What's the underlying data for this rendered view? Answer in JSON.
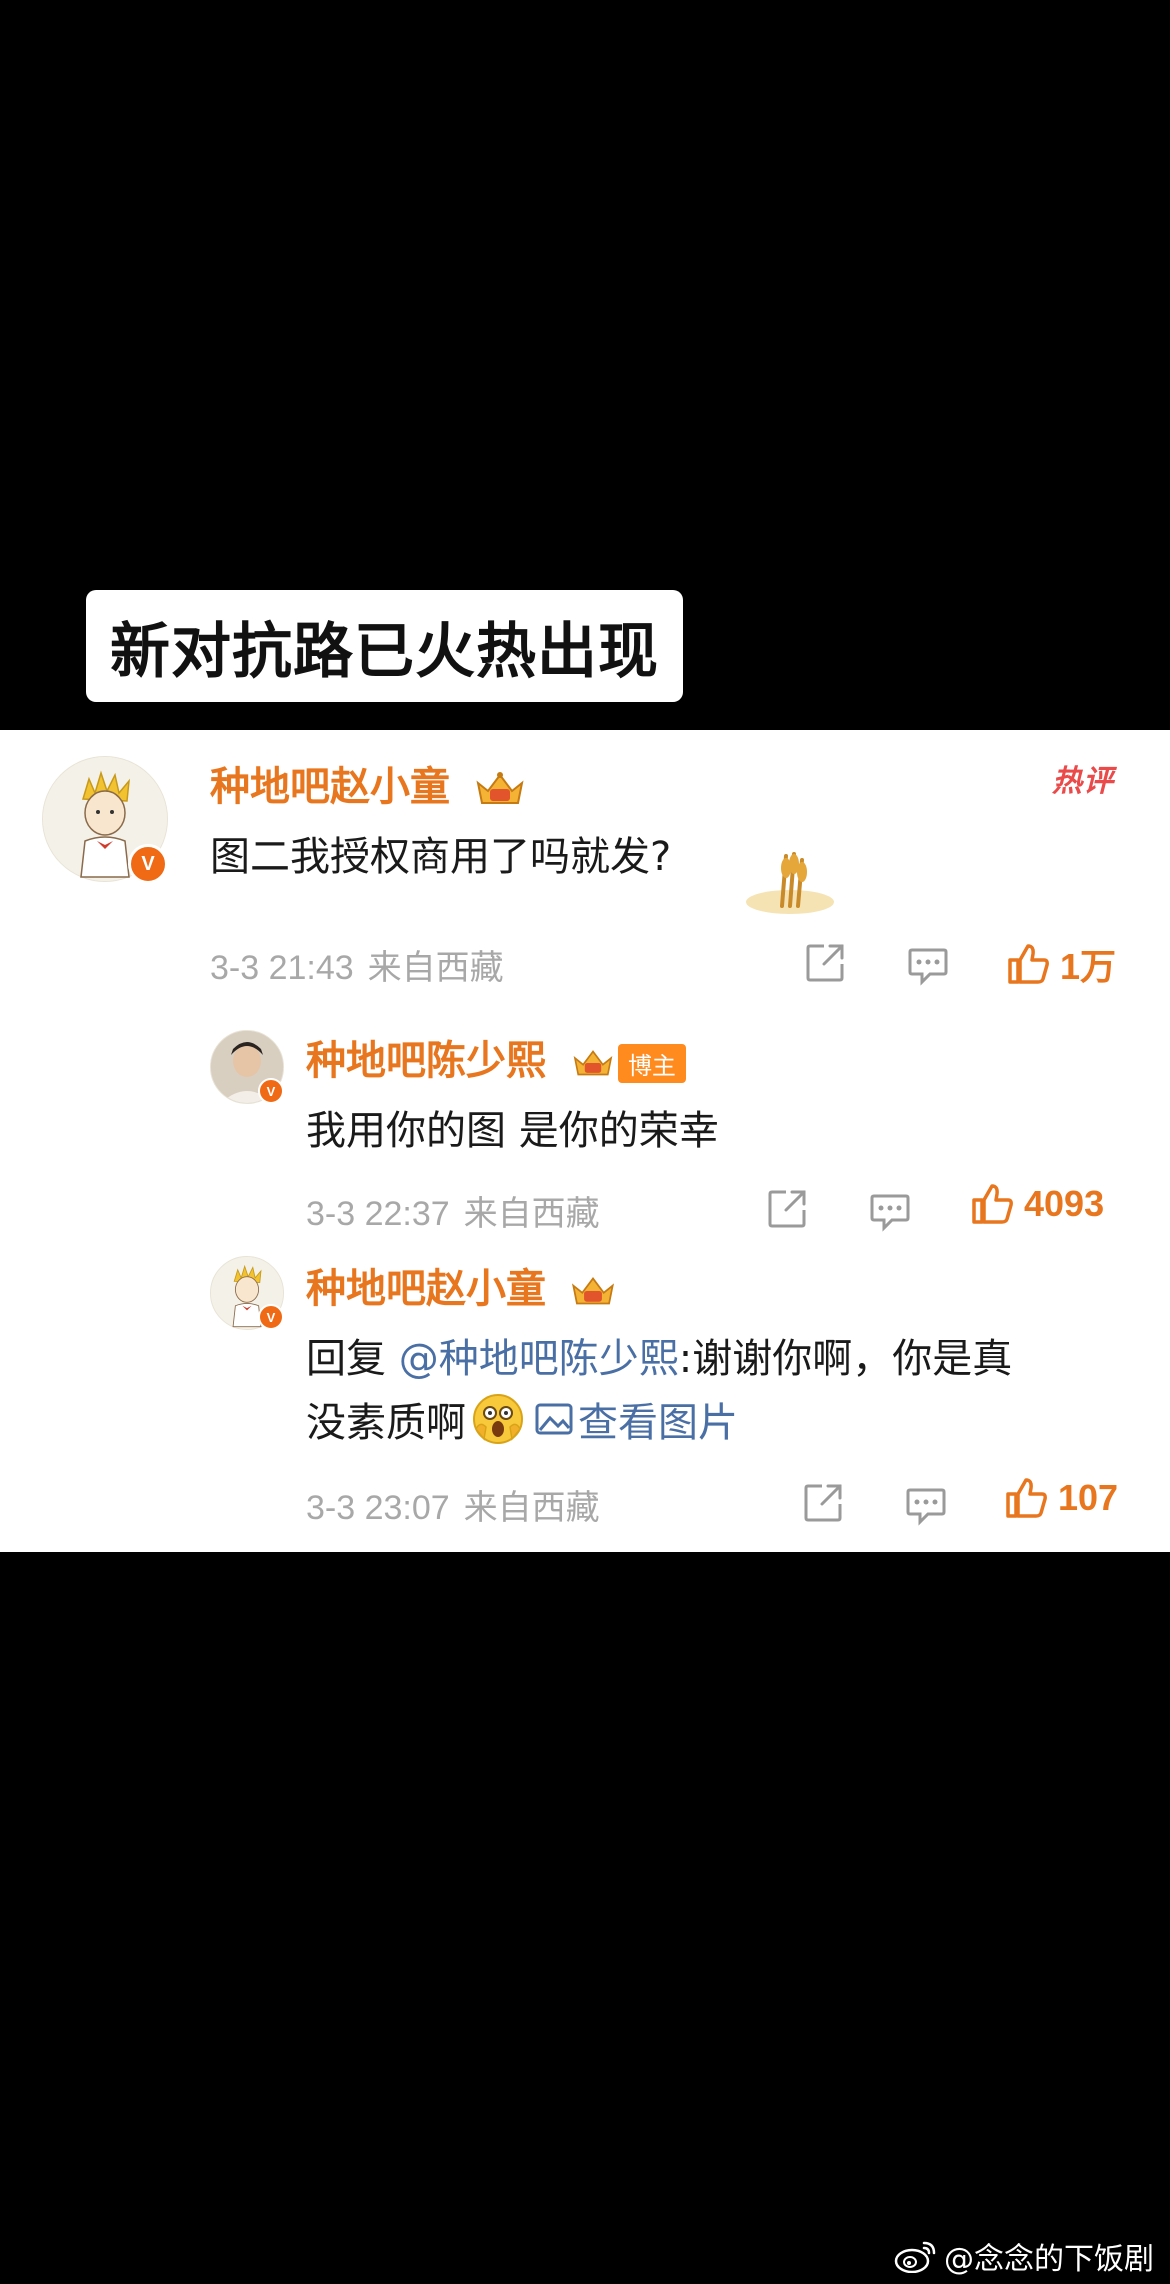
{
  "caption": "新对抗路已火热出现",
  "hot_label": "热评",
  "comments": [
    {
      "username": "种地吧赵小童",
      "text": "图二我授权商用了吗就发?",
      "time": "3-3 21:43",
      "source": "来自西藏",
      "likes": "1万",
      "verified_badge": "V"
    },
    {
      "username": "种地吧陈少熙",
      "host_tag": "博主",
      "text": "我用你的图 是你的荣幸",
      "time": "3-3 22:37",
      "source": "来自西藏",
      "likes": "4093",
      "verified_badge": "V"
    },
    {
      "username": "种地吧赵小童",
      "reply_prefix": "回复",
      "mention": "@种地吧陈少熙",
      "text_line1": ":谢谢你啊，你是真",
      "text_line2": "没素质啊",
      "view_pic": "查看图片",
      "time": "3-3 23:07",
      "source": "来自西藏",
      "likes": "107",
      "verified_badge": "V"
    }
  ],
  "watermark": "@念念的下饭剧",
  "icons": [
    "share-icon",
    "comment-icon",
    "like-icon",
    "crown-icon",
    "weibo-icon",
    "picture-icon",
    "shocked-emoji-icon"
  ],
  "colors": {
    "username": "#e8761e",
    "like": "#e8761e",
    "mention": "#4a6fa5",
    "meta": "#a8a8a8",
    "hot": "#ea4a4a"
  }
}
